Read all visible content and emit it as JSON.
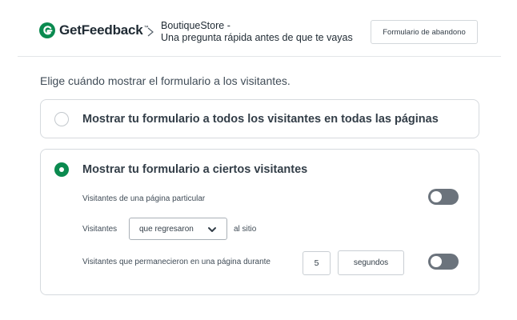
{
  "header": {
    "brand": "GetFeedback",
    "brand_tm": "™",
    "breadcrumb": {
      "line1": "BoutiqueStore -",
      "line2": "Una pregunta rápida antes de que te vayas"
    },
    "tag_button": "Formulario de abandono"
  },
  "intro": "Elige cuándo mostrar el formulario a los visitantes.",
  "options": [
    {
      "label": "Mostrar tu formulario a todos los visitantes en todas las páginas",
      "selected": false
    },
    {
      "label": "Mostrar tu formulario a ciertos visitantes",
      "selected": true
    }
  ],
  "rules": {
    "particular_page": {
      "label": "Visitantes de una página particular",
      "enabled": false
    },
    "returning": {
      "prefix": "Visitantes",
      "select_value": "que regresaron",
      "suffix": "al sitio"
    },
    "time_on_page": {
      "label": "Visitantes que permanecieron en una página durante",
      "value": "5",
      "unit": "segundos",
      "enabled": false
    }
  },
  "colors": {
    "brand_green": "#0a8a4f",
    "toggle_off": "#6b737c",
    "border": "#d6dade",
    "text": "#333e48"
  },
  "icons": {
    "logo": "getfeedback-logo-icon",
    "breadcrumb_separator": "chevron-right-icon",
    "select_caret": "chevron-down-icon"
  }
}
